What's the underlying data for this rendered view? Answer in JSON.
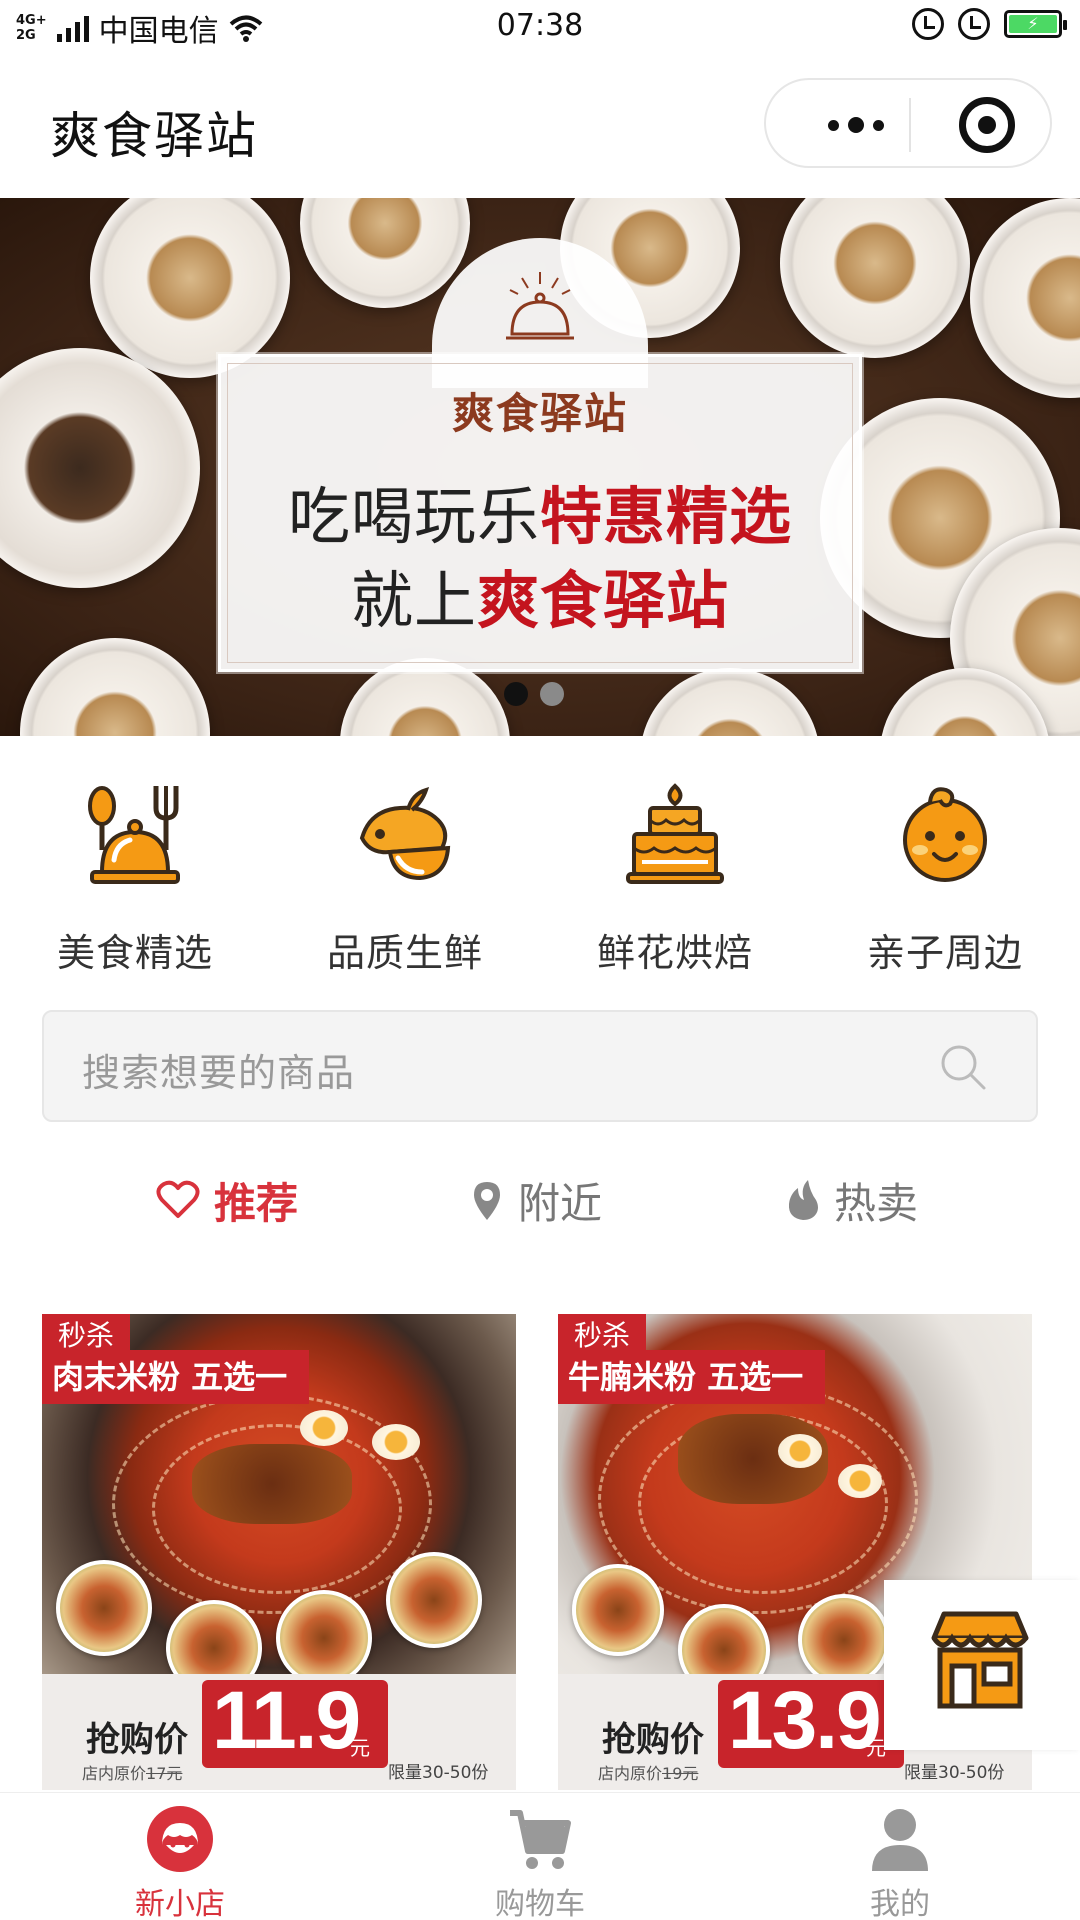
{
  "status_bar": {
    "network_top": "4G+",
    "network_bottom": "2G",
    "carrier": "中国电信",
    "time": "07:38"
  },
  "nav": {
    "title": "爽食驿站"
  },
  "banner": {
    "brand": "爽食驿站",
    "line1_plain": "吃喝玩乐",
    "line1_highlight": "特惠精选",
    "line2_plain": "就上",
    "line2_highlight": "爽食驿站",
    "slide_count": 2,
    "active_slide": 1
  },
  "categories": [
    {
      "label": "美食精选",
      "icon": "food-cloche-icon"
    },
    {
      "label": "品质生鲜",
      "icon": "fruit-icon"
    },
    {
      "label": "鲜花烘焙",
      "icon": "cake-icon"
    },
    {
      "label": "亲子周边",
      "icon": "baby-icon"
    }
  ],
  "search": {
    "placeholder": "搜索想要的商品"
  },
  "tabs": [
    {
      "label": "推荐",
      "icon": "heart-icon",
      "active": true
    },
    {
      "label": "附近",
      "icon": "location-pin-icon",
      "active": false
    },
    {
      "label": "热卖",
      "icon": "flame-icon",
      "active": false
    }
  ],
  "products": [
    {
      "flash_tag": "秒杀",
      "name": "肉末米粉 五选一",
      "price_label": "抢购价",
      "price": "11.9",
      "price_unit": "元",
      "original_price_prefix": "店内原价",
      "original_price": "17元",
      "limit": "限量30-50份"
    },
    {
      "flash_tag": "秒杀",
      "name": "牛腩米粉 五选一",
      "price_label": "抢购价",
      "price": "13.9",
      "price_unit": "元",
      "original_price_prefix": "店内原价",
      "original_price": "19元",
      "limit": "限量30-50份"
    }
  ],
  "floating_button": {
    "icon": "store-icon"
  },
  "tab_bar": [
    {
      "label": "新小店",
      "icon": "shop-avatar-icon",
      "active": true
    },
    {
      "label": "购物车",
      "icon": "cart-icon",
      "active": false
    },
    {
      "label": "我的",
      "icon": "user-icon",
      "active": false
    }
  ],
  "colors": {
    "accent": "#d8323c",
    "icon_orange": "#f59a14",
    "banner_red": "#c4141e",
    "tab_inactive": "#999999"
  }
}
